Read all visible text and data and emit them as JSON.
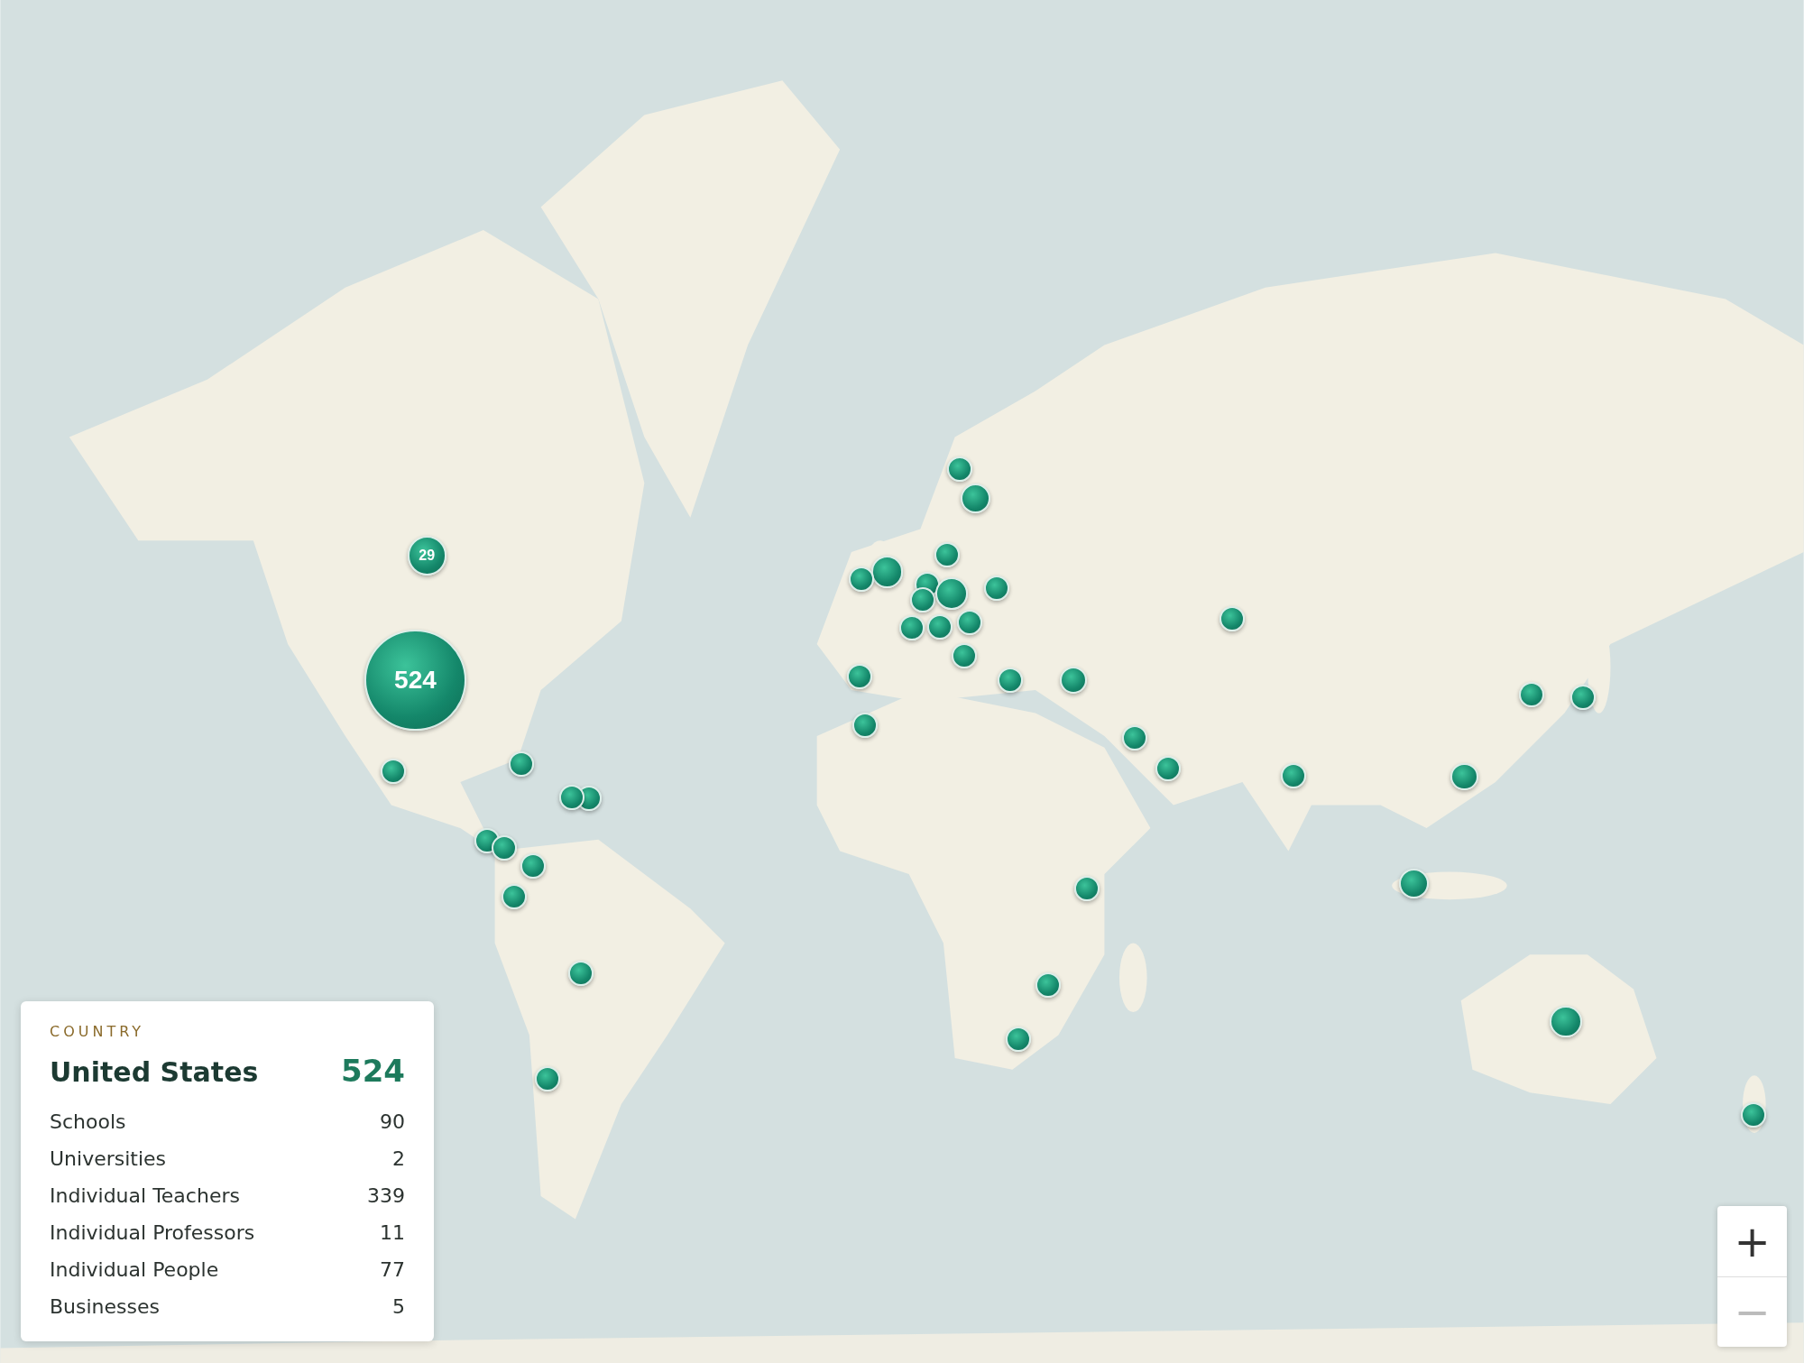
{
  "markers": [
    {
      "kind": "cluster",
      "count": "29"
    },
    {
      "kind": "cluster",
      "count": "524"
    },
    {
      "kind": "dot"
    },
    {
      "kind": "dot"
    },
    {
      "kind": "dot"
    },
    {
      "kind": "dot"
    },
    {
      "kind": "dot"
    },
    {
      "kind": "dot"
    },
    {
      "kind": "dot"
    },
    {
      "kind": "dot"
    },
    {
      "kind": "dot"
    },
    {
      "kind": "dot"
    },
    {
      "kind": "dot"
    },
    {
      "kind": "dot"
    },
    {
      "kind": "dot"
    },
    {
      "kind": "dot"
    },
    {
      "kind": "dot"
    },
    {
      "kind": "dot"
    },
    {
      "kind": "dot"
    },
    {
      "kind": "dot"
    },
    {
      "kind": "dot"
    },
    {
      "kind": "dot"
    },
    {
      "kind": "dot"
    },
    {
      "kind": "dot"
    },
    {
      "kind": "dot"
    },
    {
      "kind": "dot"
    },
    {
      "kind": "dot"
    },
    {
      "kind": "dot"
    },
    {
      "kind": "dot"
    },
    {
      "kind": "dot"
    },
    {
      "kind": "dot"
    },
    {
      "kind": "dot"
    },
    {
      "kind": "dot"
    },
    {
      "kind": "dot"
    },
    {
      "kind": "dot"
    },
    {
      "kind": "dot"
    },
    {
      "kind": "dot"
    },
    {
      "kind": "dot"
    },
    {
      "kind": "dot"
    },
    {
      "kind": "dot"
    },
    {
      "kind": "dot"
    },
    {
      "kind": "dot"
    }
  ],
  "info_card": {
    "label": "COUNTRY",
    "title": "United States",
    "total": "524",
    "rows": [
      {
        "name": "Schools",
        "value": "90"
      },
      {
        "name": "Universities",
        "value": "2"
      },
      {
        "name": "Individual Teachers",
        "value": "339"
      },
      {
        "name": "Individual Professors",
        "value": "11"
      },
      {
        "name": "Individual People",
        "value": "77"
      },
      {
        "name": "Businesses",
        "value": "5"
      }
    ]
  },
  "zoom_controls": [
    {
      "label": "+",
      "disabled": false
    },
    {
      "label": "−",
      "disabled": true
    }
  ]
}
